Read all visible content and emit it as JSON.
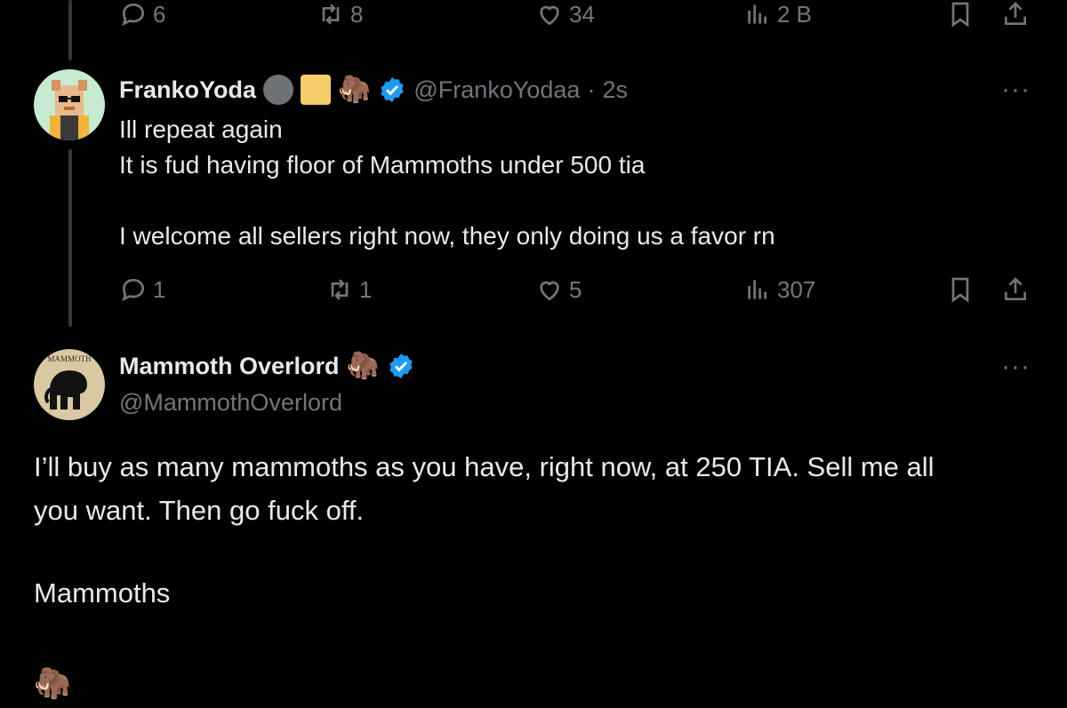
{
  "top_actions": {
    "replies": "6",
    "reposts": "8",
    "likes": "34",
    "views": "2 B"
  },
  "reply_tweet": {
    "display_name": "FrankoYoda",
    "emoji": "🦣",
    "handle": "@FrankoYodaa",
    "separator": "·",
    "time": "2s",
    "more": "···",
    "text_line1": "Ill repeat again",
    "text_line2": "It is fud having floor of Mammoths under 500 tia",
    "text_line3": "I welcome all sellers right now, they only doing us a favor rn",
    "actions": {
      "replies": "1",
      "reposts": "1",
      "likes": "5",
      "views": "307"
    }
  },
  "main_tweet": {
    "display_name": "Mammoth Overlord",
    "emoji": "🦣",
    "handle": "@MammothOverlord",
    "more": "···",
    "avatar_text": "MAMMOTH",
    "text_line1": "I’ll buy as many mammoths as you have, right now, at 250 TIA. Sell me all",
    "text_line2": "you want. Then go fuck off.",
    "text_line3": "Mammoths",
    "text_emoji": "🦣"
  },
  "colors": {
    "background": "#000000",
    "text": "#e7e9ea",
    "muted": "#71767b",
    "verified": "#1d9bf0",
    "square_badge": "#f4cc6a"
  },
  "icons": [
    "reply-icon",
    "repost-icon",
    "like-icon",
    "views-icon",
    "bookmark-icon",
    "share-icon",
    "verified-badge-icon"
  ]
}
